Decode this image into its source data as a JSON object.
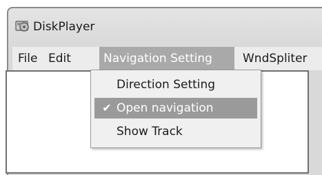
{
  "window": {
    "title": "DiskPlayer"
  },
  "menubar": {
    "items": [
      {
        "label": "File"
      },
      {
        "label": "Edit"
      },
      {
        "label": "Navigation Setting"
      },
      {
        "label": "WndSpliter"
      }
    ]
  },
  "dropdown": {
    "items": [
      {
        "label": "Direction Setting",
        "checked": false
      },
      {
        "label": "Open navigation",
        "checked": true
      },
      {
        "label": "Show Track",
        "checked": false
      }
    ],
    "check_glyph": "✔"
  },
  "colors": {
    "highlight": "#9a9a9a",
    "open_menu": "#a9a9a9",
    "menu_bg": "#f0f0f0",
    "chrome": "#d9d9d9"
  },
  "icons": {
    "app": "disk-player-icon",
    "check": "checkmark-icon"
  }
}
